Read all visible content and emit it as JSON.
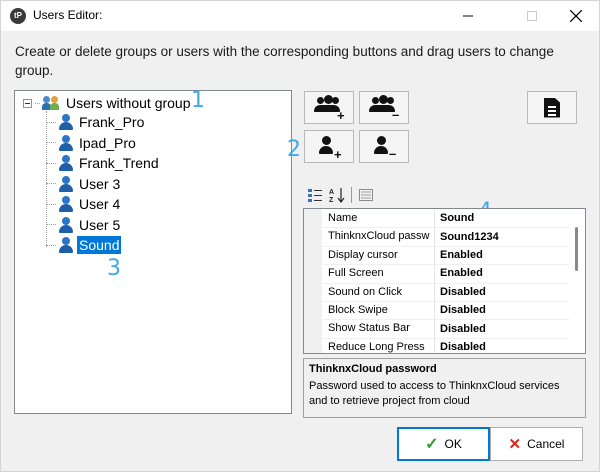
{
  "window": {
    "title": "Users Editor:",
    "app_icon_text": "tP"
  },
  "instructions": "Create or delete groups or users with the corresponding buttons and drag users to change group.",
  "tree": {
    "root_label": "Users without group",
    "users": [
      "Frank_Pro",
      "Ipad_Pro",
      "Frank_Trend",
      "User 3",
      "User 4",
      "User 5",
      "Sound"
    ],
    "selected_user": "Sound"
  },
  "annotations": [
    "1",
    "2",
    "3",
    "4"
  ],
  "toolbar": {
    "add_group_icon": "add-group-icon",
    "remove_group_icon": "remove-group-icon",
    "add_user_icon": "add-user-icon",
    "remove_user_icon": "remove-user-icon",
    "document_icon": "document-icon"
  },
  "property_grid": {
    "rows": [
      {
        "name": "Name",
        "value": "Sound"
      },
      {
        "name": "ThinknxCloud passw",
        "value": "Sound1234"
      },
      {
        "name": "Display cursor",
        "value": "Enabled"
      },
      {
        "name": "Full Screen",
        "value": "Enabled"
      },
      {
        "name": "Sound on Click",
        "value": "Disabled"
      },
      {
        "name": "Block Swipe",
        "value": "Disabled"
      },
      {
        "name": "Show Status Bar",
        "value": "Disabled"
      },
      {
        "name": "Reduce Long Press",
        "value": "Disabled"
      }
    ]
  },
  "help": {
    "title": "ThinknxCloud password",
    "description": "Password used to access to ThinknxCloud services and to retrieve project from cloud"
  },
  "buttons": {
    "ok": "OK",
    "cancel": "Cancel"
  }
}
